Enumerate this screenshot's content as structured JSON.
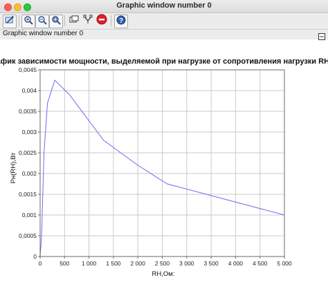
{
  "window": {
    "title": "Graphic window number 0"
  },
  "toolbar": {
    "icons": [
      "rotate-icon",
      "zoom-in-icon",
      "zoom-out-icon",
      "zoom-fit-icon",
      "windows-icon",
      "datatip-icon",
      "stop-icon",
      "help-icon"
    ]
  },
  "panel": {
    "title": "Graphic window number 0"
  },
  "colors": {
    "line": "#6b6bf0",
    "grid": "#c9c9c9",
    "stop": "#e0202a"
  },
  "chart_data": {
    "type": "line",
    "title": "График зависимости мощности, выделяемой при нагрузке от сопротивления нагрузки RH",
    "xlabel": "RH,Ом:",
    "ylabel": "Pн(RH),Вт",
    "xlim": [
      0,
      5000
    ],
    "ylim": [
      0,
      0.0045
    ],
    "xticks": [
      "0",
      "500",
      "1 000",
      "1 500",
      "2 000",
      "2 500",
      "3 000",
      "3 500",
      "4 000",
      "4 500",
      "5 000"
    ],
    "yticks": [
      "0",
      "0,0005",
      "0,001",
      "0,0015",
      "0,002",
      "0,0025",
      "0,003",
      "0,0035",
      "0,004",
      "0,0045"
    ],
    "grid": true,
    "series": [
      {
        "x": [
          0,
          30,
          80,
          150,
          300,
          600,
          1300,
          2000,
          2600,
          5000
        ],
        "y": [
          0,
          0.0005,
          0.0025,
          0.0037,
          0.00425,
          0.0039,
          0.0028,
          0.0022,
          0.00175,
          0.001
        ]
      }
    ]
  }
}
